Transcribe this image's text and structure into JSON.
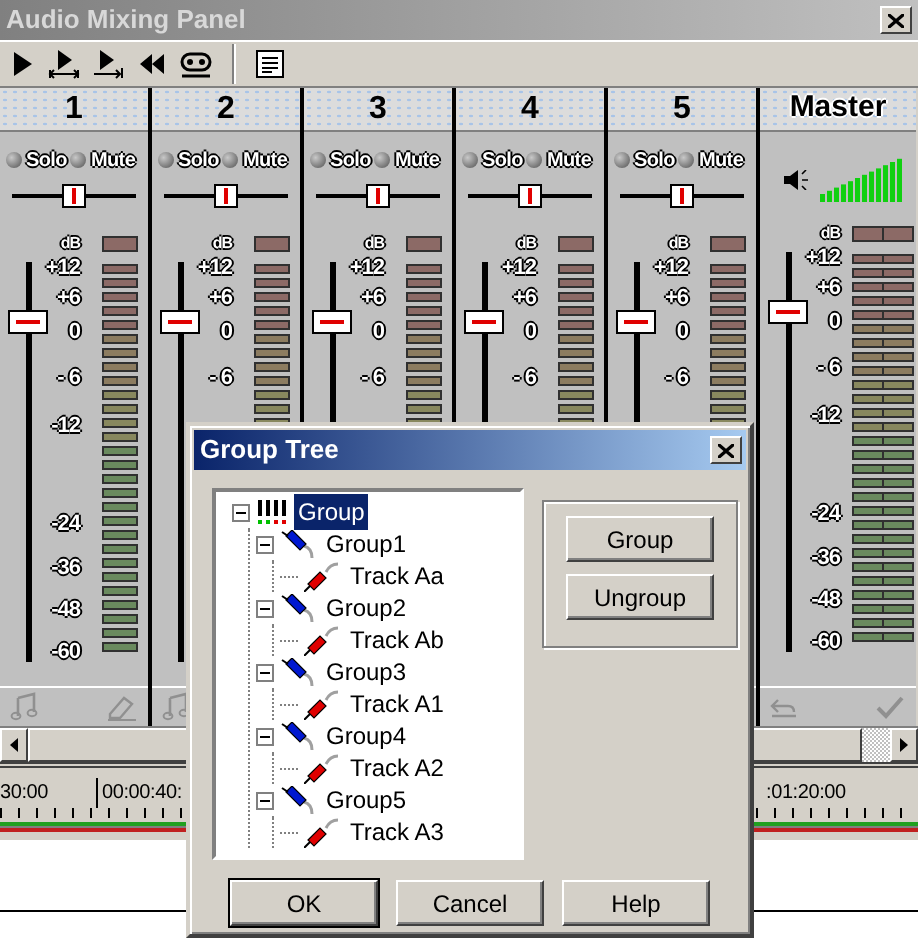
{
  "window": {
    "title": "Audio Mixing Panel"
  },
  "channels": [
    {
      "name": "1",
      "solo": {
        "label": "Solo",
        "on": false
      },
      "mute": {
        "label": "Mute",
        "on": false
      },
      "pan": {
        "level": 0.5
      },
      "fader": {
        "level": 0.85
      },
      "scale": [
        "dB",
        "+12",
        "+6",
        "0",
        "- 6",
        "-12",
        "-24",
        "-36",
        "-48",
        "-60"
      ]
    },
    {
      "name": "2",
      "solo": {
        "label": "Solo",
        "on": false
      },
      "mute": {
        "label": "Mute",
        "on": false
      },
      "pan": {
        "level": 0.5
      },
      "fader": {
        "level": 0.85
      },
      "scale": [
        "dB",
        "+12",
        "+6",
        "0",
        "- 6"
      ]
    },
    {
      "name": "3",
      "solo": {
        "label": "Solo",
        "on": false
      },
      "mute": {
        "label": "Mute",
        "on": false
      },
      "pan": {
        "level": 0.5
      },
      "fader": {
        "level": 0.85
      },
      "scale": [
        "dB",
        "+12",
        "+6",
        "0",
        "- 6"
      ]
    },
    {
      "name": "4",
      "solo": {
        "label": "Solo",
        "on": false
      },
      "mute": {
        "label": "Mute",
        "on": false
      },
      "pan": {
        "level": 0.5
      },
      "fader": {
        "level": 0.85
      },
      "scale": [
        "dB",
        "+12",
        "+6",
        "0",
        "- 6"
      ]
    },
    {
      "name": "5",
      "solo": {
        "label": "Solo",
        "on": false
      },
      "mute": {
        "label": "Mute",
        "on": false
      },
      "pan": {
        "level": 0.5
      },
      "fader": {
        "level": 0.85
      },
      "scale": [
        "dB",
        "+12",
        "+6",
        "0",
        "- 6"
      ]
    }
  ],
  "master": {
    "name": "Master",
    "volume": {
      "level": 1
    },
    "fader": {
      "level": 0.85
    },
    "scale": [
      "dB",
      "+12",
      "+6",
      "0",
      "- 6",
      "-12",
      "-24",
      "-36",
      "-48",
      "-60"
    ]
  },
  "timeline": {
    "ruler_labels": [
      "30:00",
      "00:00:40:",
      ":01:20:00"
    ]
  },
  "dialog": {
    "title": "Group Tree",
    "tree": [
      {
        "label": "Group",
        "kind": "root",
        "expanded": true,
        "selected": true,
        "children": [
          {
            "label": "Group1",
            "kind": "group",
            "expanded": true,
            "selected": false,
            "children": [
              {
                "label": "Track Aa",
                "kind": "track",
                "selected": false
              }
            ]
          },
          {
            "label": "Group2",
            "kind": "group",
            "expanded": true,
            "selected": false,
            "children": [
              {
                "label": "Track Ab",
                "kind": "track",
                "selected": false
              }
            ]
          },
          {
            "label": "Group3",
            "kind": "group",
            "expanded": true,
            "selected": false,
            "children": [
              {
                "label": "Track A1",
                "kind": "track",
                "selected": false
              }
            ]
          },
          {
            "label": "Group4",
            "kind": "group",
            "expanded": true,
            "selected": false,
            "children": [
              {
                "label": "Track A2",
                "kind": "track",
                "selected": false
              }
            ]
          },
          {
            "label": "Group5",
            "kind": "group",
            "expanded": true,
            "selected": false,
            "children": [
              {
                "label": "Track A3",
                "kind": "track",
                "selected": false
              }
            ]
          }
        ]
      }
    ],
    "side_buttons": [
      "Group",
      "Ungroup"
    ],
    "buttons": [
      {
        "label": "OK",
        "default": true
      },
      {
        "label": "Cancel",
        "default": false
      },
      {
        "label": "Help",
        "default": false
      }
    ]
  }
}
